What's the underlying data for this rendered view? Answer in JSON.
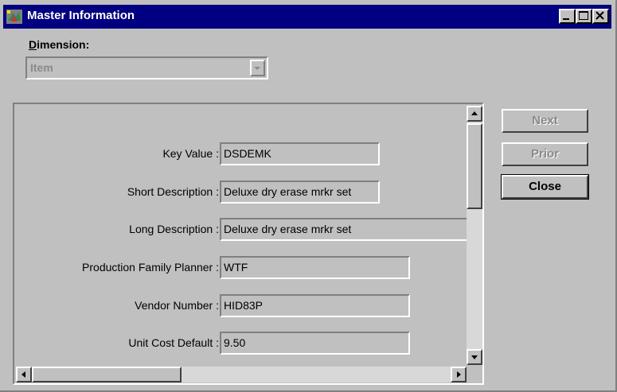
{
  "window": {
    "title": "Master Information"
  },
  "dimension": {
    "label_prefix": "D",
    "label_rest": "imension:",
    "value": "Item"
  },
  "fields": [
    {
      "label": "Key Value :",
      "value": "DSDEMK"
    },
    {
      "label": "Short Description :",
      "value": "Deluxe dry erase mrkr set"
    },
    {
      "label": "Long Description :",
      "value": "Deluxe dry erase mrkr set"
    },
    {
      "label": "Production Family Planner :",
      "value": "WTF"
    },
    {
      "label": "Vendor Number :",
      "value": "HID83P"
    },
    {
      "label": "Unit Cost Default :",
      "value": "9.50"
    }
  ],
  "buttons": {
    "next": "Next",
    "prior": "Prior",
    "close": "Close"
  }
}
